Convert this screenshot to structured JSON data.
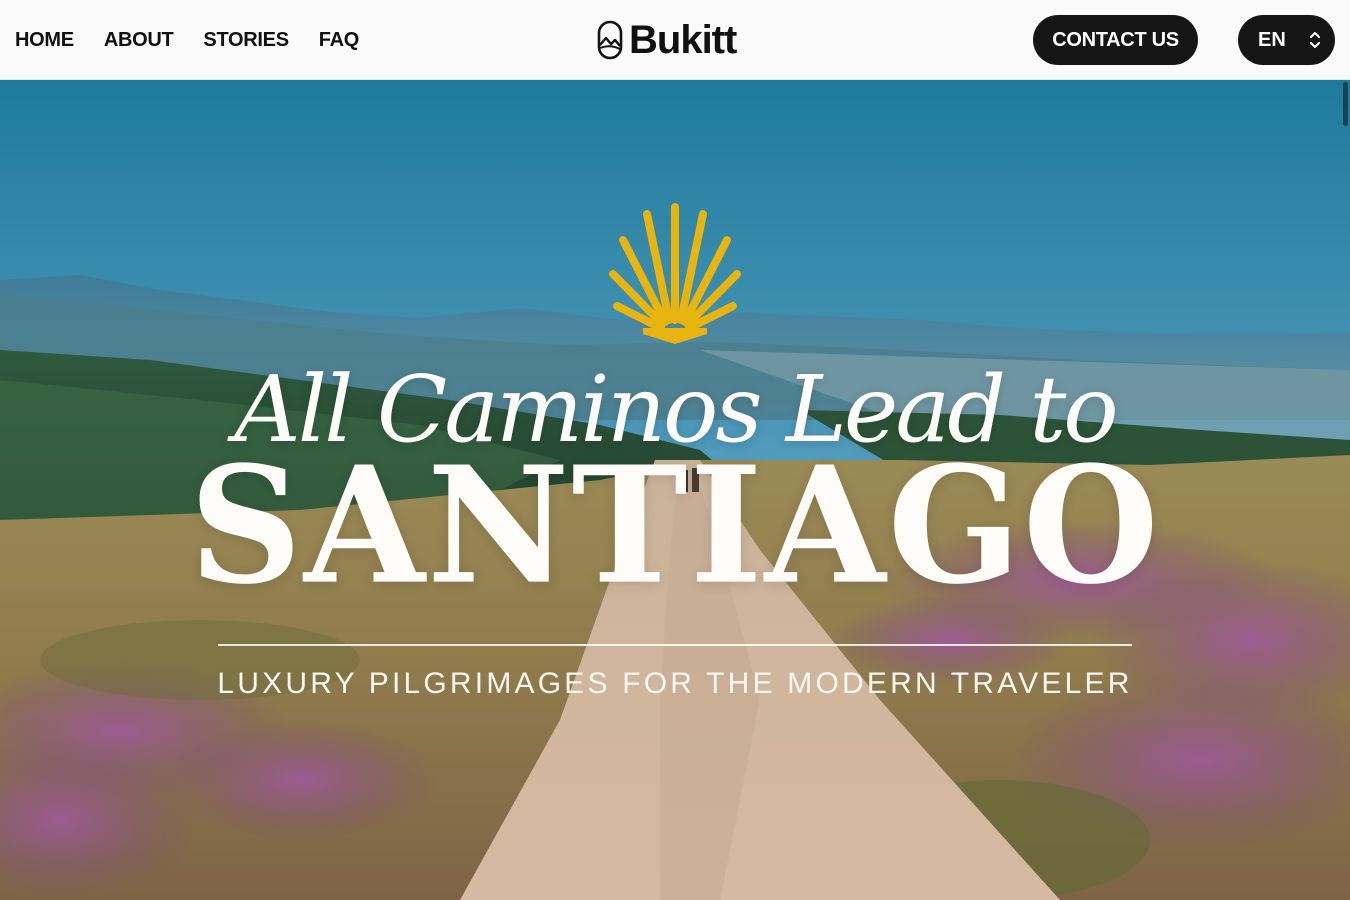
{
  "header": {
    "nav": [
      "HOME",
      "ABOUT",
      "STORIES",
      "FAQ"
    ],
    "logo_text": "Bukitt",
    "contact_label": "CONTACT US",
    "language": "EN"
  },
  "hero": {
    "script_title": "All Caminos Lead to",
    "main_title": "SANTIAGO",
    "tagline": "LUXURY PILGRIMAGES FOR THE MODERN TRAVELER",
    "shell_icon": "scallop-shell-icon"
  },
  "colors": {
    "header_bg": "#fafafa",
    "button_bg": "#161616",
    "shell": "#e8b40f",
    "title_text": "#fdfcf8"
  }
}
